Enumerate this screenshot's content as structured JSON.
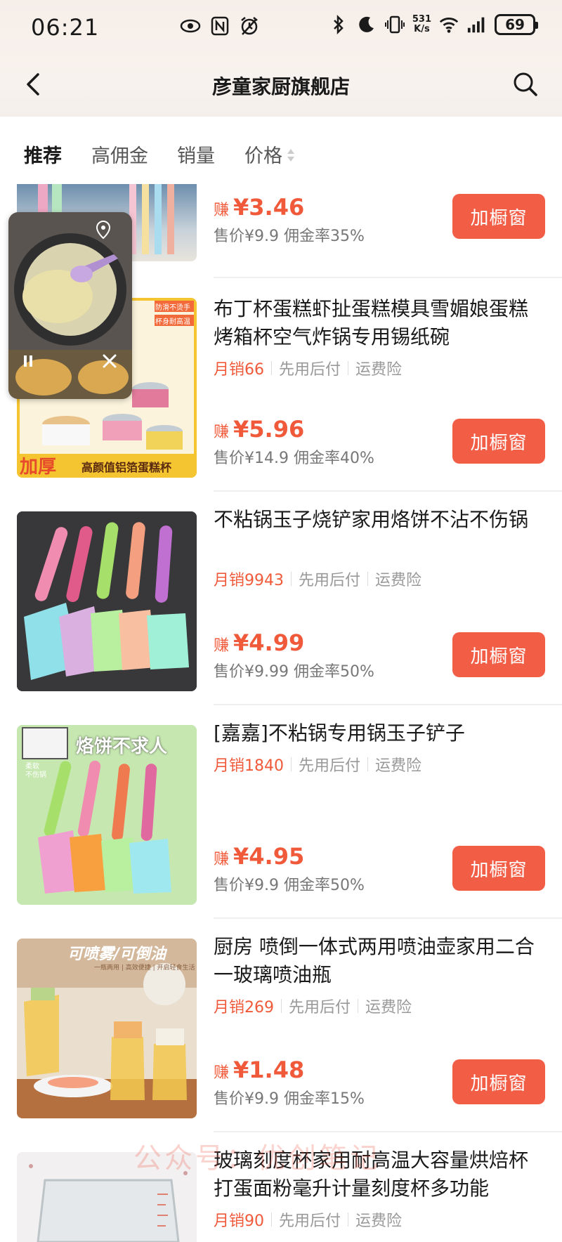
{
  "status_bar": {
    "time": "06:21",
    "net_speed_top": "531",
    "net_speed_unit": "K/s",
    "battery": "69"
  },
  "header": {
    "title": "彦童家厨旗舰店"
  },
  "tabs": [
    {
      "label": "推荐",
      "active": true
    },
    {
      "label": "高佣金",
      "active": false
    },
    {
      "label": "销量",
      "active": false
    },
    {
      "label": "价格",
      "active": false
    }
  ],
  "items": [
    {
      "title": "",
      "earn_prefix": "赚",
      "earn": "¥3.46",
      "sale": "售价¥9.9 佣金率35%",
      "button": "加橱窗"
    },
    {
      "title": "布丁杯蛋糕虾扯蛋糕模具雪媚娘蛋糕烤箱杯空气炸锅专用锡纸碗",
      "sales": "月销66",
      "tag1": "先用后付",
      "tag2": "运费险",
      "earn_prefix": "赚",
      "earn": "¥5.96",
      "sale": "售价¥14.9 佣金率40%",
      "button": "加橱窗",
      "thumb_text_main": "加厚",
      "thumb_text_sub": "高颜值铝箔蛋糕杯",
      "thumb_tag1": "防滑不烫手",
      "thumb_tag2": "杯身耐高温"
    },
    {
      "title": "不粘锅玉子烧铲家用烙饼不沾不伤锅",
      "sales": "月销9943",
      "tag1": "先用后付",
      "tag2": "运费险",
      "earn_prefix": "赚",
      "earn": "¥4.99",
      "sale": "售价¥9.99 佣金率50%",
      "button": "加橱窗"
    },
    {
      "title": "[嘉嘉]不粘锅专用锅玉子铲子",
      "sales": "月销1840",
      "tag1": "先用后付",
      "tag2": "运费险",
      "earn_prefix": "赚",
      "earn": "¥4.95",
      "sale": "售价¥9.9 佣金率50%",
      "button": "加橱窗",
      "thumb_text_main": "烙饼不求人",
      "thumb_text_sub1": "柔软",
      "thumb_text_sub2": "不伤锅"
    },
    {
      "title": "厨房 喷倒一体式两用喷油壶家用二合一玻璃喷油瓶",
      "sales": "月销269",
      "tag1": "先用后付",
      "tag2": "运费险",
      "earn_prefix": "赚",
      "earn": "¥1.48",
      "sale": "售价¥9.9 佣金率15%",
      "button": "加橱窗",
      "thumb_text_main": "可喷雾/可倒油",
      "thumb_text_sub": "一瓶两用 | 高效便捷 | 开启轻食生活"
    },
    {
      "title": "玻璃刻度杯家用耐高温大容量烘焙杯打蛋面粉毫升计量刻度杯多功能",
      "sales": "月销90",
      "tag1": "先用后付",
      "tag2": "运费险"
    }
  ],
  "watermark": "公众号：优创笔记"
}
